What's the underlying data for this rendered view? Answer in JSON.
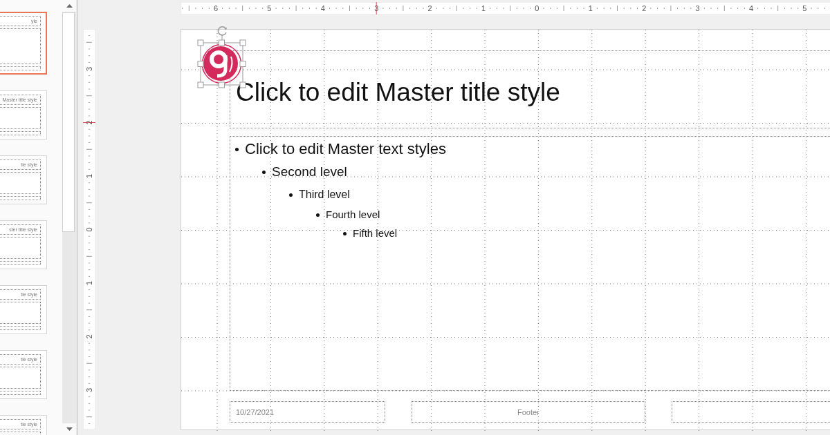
{
  "thumbnails": [
    {
      "title": "yle",
      "selected": true
    },
    {
      "title": "Master title style",
      "selected": false
    },
    {
      "title": "tle style",
      "selected": false
    },
    {
      "title": "ster title style",
      "selected": false
    },
    {
      "title": "tle style",
      "selected": false
    },
    {
      "title": "tle style",
      "selected": false
    },
    {
      "title": "tle style",
      "selected": false
    }
  ],
  "ruler_horizontal": [
    "6",
    "5",
    "4",
    "3",
    "2",
    "1",
    "0",
    "1",
    "2",
    "3",
    "4",
    "5"
  ],
  "ruler_vertical": [
    "3",
    "2",
    "1",
    "0",
    "1",
    "2",
    "3"
  ],
  "slide": {
    "title": "Click to edit Master title style",
    "body": [
      {
        "text": "Click to edit Master text styles",
        "children": [
          {
            "text": "Second level",
            "children": [
              {
                "text": "Third level",
                "children": [
                  {
                    "text": "Fourth level",
                    "children": [
                      {
                        "text": "Fifth level"
                      }
                    ]
                  }
                ]
              }
            ]
          }
        ]
      }
    ],
    "date": "10/27/2021",
    "footer": "Footer"
  }
}
